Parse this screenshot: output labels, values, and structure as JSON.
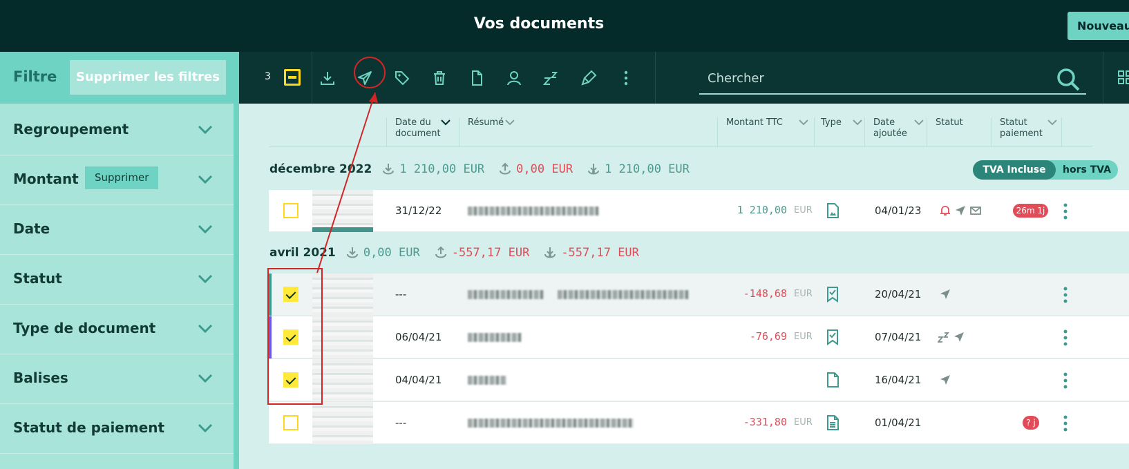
{
  "header": {
    "title": "Vos documents",
    "new_button": "Nouveau"
  },
  "sidebar": {
    "filter_label": "Filtre",
    "clear_filters": "Supprimer les filtres",
    "items": [
      {
        "label": "Regroupement"
      },
      {
        "label": "Montant",
        "remove_label": "Supprimer"
      },
      {
        "label": "Date"
      },
      {
        "label": "Statut"
      },
      {
        "label": "Type de document"
      },
      {
        "label": "Balises"
      },
      {
        "label": "Statut de paiement"
      }
    ]
  },
  "toolbar": {
    "selected_count": "3",
    "icons": [
      "download-icon",
      "send-icon",
      "tag-icon",
      "trash-icon",
      "document-icon",
      "user-icon",
      "snooze-icon",
      "sign-icon",
      "more-icon"
    ],
    "search_placeholder": "Chercher"
  },
  "table": {
    "columns": {
      "date_line1": "Date du",
      "date_line2": "document",
      "summary": "Résumé",
      "amount": "Montant TTC",
      "type": "Type",
      "added_line1": "Date",
      "added_line2": "ajoutée",
      "status": "Statut",
      "payment_line1": "Statut",
      "payment_line2": "paiement"
    },
    "vat_toggle": {
      "included": "TVA Incluse",
      "excluded": "hors TVA"
    },
    "groups": [
      {
        "name": "décembre 2022",
        "incoming": "1 210,00 EUR",
        "outgoing": "0,00 EUR",
        "balance": "1 210,00 EUR",
        "rows": [
          {
            "checked": false,
            "date": "31/12/22",
            "amount": "1 210,00",
            "currency": "EUR",
            "type_icon": "receipt-icon",
            "added": "04/01/23",
            "status_icons": [
              "bell-icon",
              "send-icon",
              "mail-icon"
            ],
            "payment_badge": "26m 1j"
          }
        ]
      },
      {
        "name": "avril 2021",
        "incoming": "0,00 EUR",
        "outgoing": "-557,17 EUR",
        "balance": "-557,17 EUR",
        "rows": [
          {
            "checked": true,
            "date": "---",
            "amount": "-148,68",
            "currency": "EUR",
            "type_icon": "invoice-icon",
            "added": "20/04/21",
            "status_icons": [
              "send-icon"
            ],
            "payment_badge": ""
          },
          {
            "checked": true,
            "date": "06/04/21",
            "amount": "-76,69",
            "currency": "EUR",
            "type_icon": "invoice-icon",
            "added": "07/04/21",
            "status_icons": [
              "snooze-icon",
              "send-icon"
            ],
            "payment_badge": ""
          },
          {
            "checked": true,
            "date": "04/04/21",
            "amount": "",
            "currency": "",
            "type_icon": "document-icon",
            "added": "16/04/21",
            "status_icons": [
              "send-icon"
            ],
            "payment_badge": ""
          },
          {
            "checked": false,
            "date": "---",
            "amount": "-331,80",
            "currency": "EUR",
            "type_icon": "text-document-icon",
            "added": "01/04/21",
            "status_icons": [],
            "payment_badge": "? j"
          }
        ]
      }
    ]
  },
  "colors": {
    "header_bg": "#042a2a",
    "toolbar_bg": "#0b3532",
    "sidebar_bg": "#a8e4da",
    "accent_teal": "#6ed3c3",
    "selection_yellow": "#ffe93a",
    "negative_red": "#e14c58",
    "annotation_red": "#d32525"
  }
}
